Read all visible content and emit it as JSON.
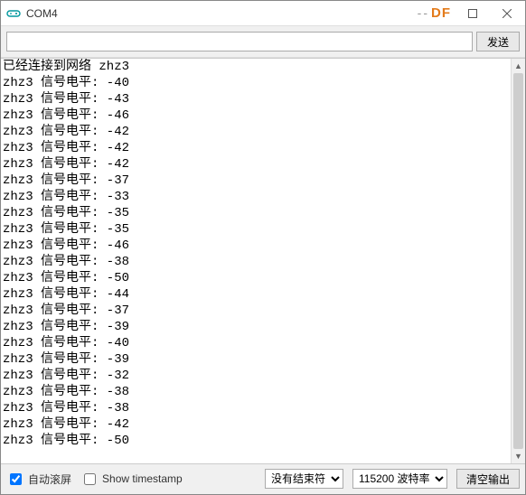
{
  "window": {
    "title": "COM4",
    "watermark_prefix": "--",
    "watermark": "DF"
  },
  "input": {
    "value": "",
    "send_label": "发送"
  },
  "output": {
    "first_line": "已经连接到网络 zhz3",
    "prefix": "zhz3 信号电平: ",
    "values": [
      -40,
      -43,
      -46,
      -42,
      -42,
      -42,
      -37,
      -33,
      -35,
      -35,
      -46,
      -38,
      -50,
      -44,
      -37,
      -39,
      -40,
      -39,
      -32,
      -38,
      -38,
      -42,
      -50
    ]
  },
  "footer": {
    "autoscroll_label": "自动滚屏",
    "autoscroll_checked": true,
    "timestamp_label": "Show timestamp",
    "timestamp_checked": false,
    "line_ending": "没有结束符",
    "baud_value": "115200",
    "baud_label": "波特率",
    "clear_label": "清空输出"
  }
}
